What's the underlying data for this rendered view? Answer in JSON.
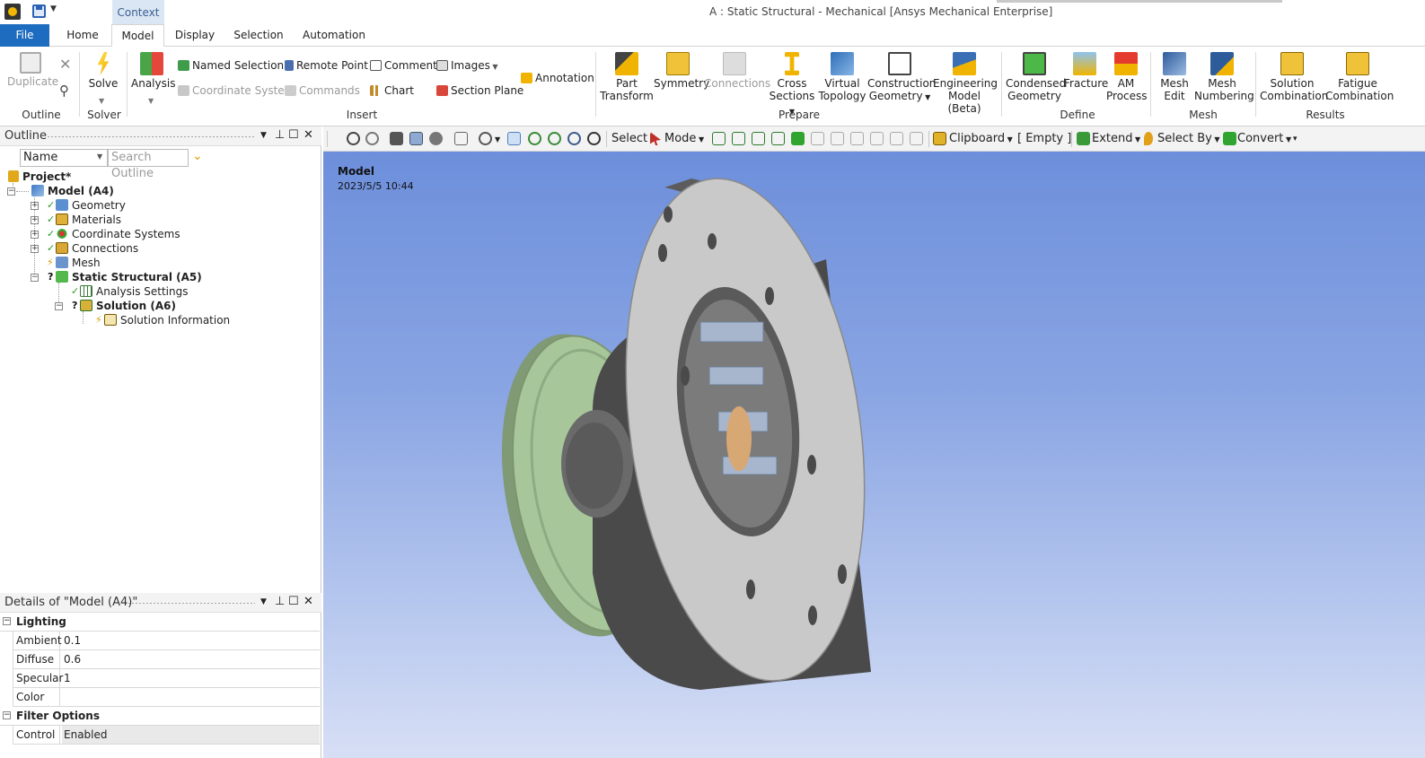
{
  "window": {
    "title": "A : Static Structural - Mechanical [Ansys Mechanical Enterprise]",
    "context_tab": "Context"
  },
  "tabs": [
    "File",
    "Home",
    "Model",
    "Display",
    "Selection",
    "Automation"
  ],
  "active_tab": "Model",
  "ribbon": {
    "outline_group": {
      "label": "Outline",
      "duplicate": "Duplicate"
    },
    "solver_group": {
      "label": "Solver",
      "solve": "Solve"
    },
    "analysis": "Analysis",
    "insert_group": {
      "label": "Insert",
      "named_selection": "Named Selection",
      "remote_point": "Remote Point",
      "comment": "Comment",
      "images": "Images",
      "coordinate_system": "Coordinate System",
      "commands": "Commands",
      "chart": "Chart",
      "section_plane": "Section Plane",
      "annotation": "Annotation"
    },
    "prepare_group": {
      "label": "Prepare",
      "part_transform": [
        "Part",
        "Transform"
      ],
      "symmetry": "Symmetry",
      "connections": "Connections",
      "cross_sections": [
        "Cross",
        "Sections"
      ],
      "virtual_topology": [
        "Virtual",
        "Topology"
      ],
      "construction_geometry": [
        "Construction",
        "Geometry"
      ],
      "engineering_model": [
        "Engineering",
        "Model (Beta)"
      ]
    },
    "define_group": {
      "label": "Define",
      "condensed_geometry": [
        "Condensed",
        "Geometry"
      ],
      "fracture": "Fracture",
      "am_process": [
        "AM",
        "Process"
      ]
    },
    "mesh_group": {
      "label": "Mesh",
      "mesh_edit": [
        "Mesh",
        "Edit"
      ],
      "mesh_numbering": [
        "Mesh",
        "Numbering"
      ]
    },
    "results_group": {
      "label": "Results",
      "solution_combination": [
        "Solution",
        "Combination"
      ],
      "fatigue_combination": [
        "Fatigue",
        "Combination"
      ]
    }
  },
  "outline": {
    "title": "Outline",
    "filter_value": "Name",
    "search_placeholder": "Search Outline",
    "tree": [
      {
        "label": "Project*",
        "bold": true
      },
      {
        "label": "Model (A4)",
        "bold": true
      },
      {
        "label": "Geometry",
        "bold": false
      },
      {
        "label": "Materials",
        "bold": false
      },
      {
        "label": "Coordinate Systems",
        "bold": false
      },
      {
        "label": "Connections",
        "bold": false
      },
      {
        "label": "Mesh",
        "bold": false
      },
      {
        "label": "Static Structural (A5)",
        "bold": true
      },
      {
        "label": "Analysis Settings",
        "bold": false
      },
      {
        "label": "Solution (A6)",
        "bold": true
      },
      {
        "label": "Solution Information",
        "bold": false
      }
    ]
  },
  "details": {
    "title": "Details of \"Model (A4)\"",
    "categories": [
      {
        "name": "Lighting",
        "rows": [
          {
            "key": "Ambient",
            "value": "0.1"
          },
          {
            "key": "Diffuse",
            "value": "0.6"
          },
          {
            "key": "Specular",
            "value": "1"
          },
          {
            "key": "Color",
            "value": ""
          }
        ]
      },
      {
        "name": "Filter Options",
        "rows": [
          {
            "key": "Control",
            "value": "Enabled"
          }
        ]
      }
    ]
  },
  "graphics_toolbar": {
    "select": "Select",
    "mode": "Mode",
    "clipboard": "Clipboard",
    "empty": "[ Empty ]",
    "extend": "Extend",
    "select_by": "Select By",
    "convert": "Convert"
  },
  "viewport": {
    "title": "Model",
    "timestamp": "2023/5/5 10:44"
  },
  "colors": {
    "file_tab": "#1e6cc0",
    "viewport_top": "#6d8fdb",
    "viewport_bottom": "#d7dff5",
    "flange_face": "#c9c9c9",
    "pulley_face": "#a7c79b"
  }
}
